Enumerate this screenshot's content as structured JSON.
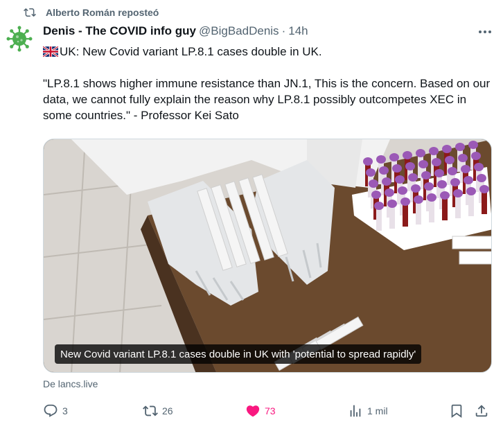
{
  "repost": {
    "text": "Alberto Román reposteó"
  },
  "tweet": {
    "author_name": "Denis - The COVID info guy",
    "handle": "@BigBadDenis",
    "separator": "·",
    "time": "14h",
    "text_line1": "UK: New Covid variant LP.8.1 cases double in UK.",
    "quote": "\"LP.8.1 shows higher immune resistance than JN.1, This is the concern. Based on our data, we cannot fully explain the reason why LP.8.1 possibly outcompetes XEC in some countries.\" - Professor Kei Sato"
  },
  "media": {
    "caption": "New Covid variant LP.8.1 cases double in UK with 'potential to spread rapidly'"
  },
  "source": {
    "text": "De lancs.live"
  },
  "actions": {
    "replies": "3",
    "retweets": "26",
    "likes": "73",
    "views": "1 mil"
  },
  "colors": {
    "muted": "#536471",
    "like": "#f91880",
    "text": "#0f1419"
  },
  "icons": [
    "retweet-icon",
    "virus-icon",
    "uk-flag-icon",
    "more-icon",
    "reply-icon",
    "like-icon",
    "views-icon",
    "bookmark-icon",
    "share-icon"
  ]
}
